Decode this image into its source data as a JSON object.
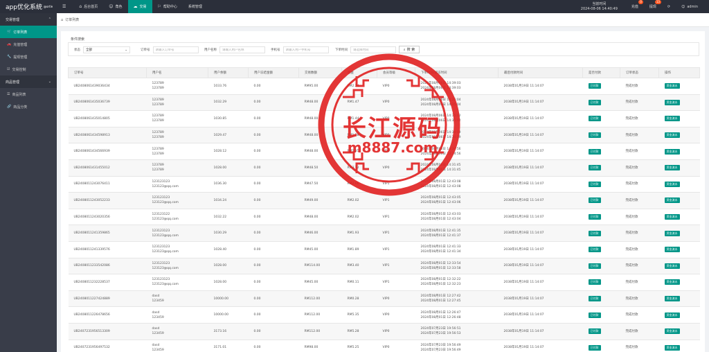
{
  "app": {
    "title": "app优化系统",
    "version": "@ortle"
  },
  "topnav": [
    {
      "icon": "menu-icon",
      "label": ""
    },
    {
      "icon": "home-icon",
      "label": "后台首页"
    },
    {
      "icon": "user-icon",
      "label": "角色"
    },
    {
      "icon": "transaction-icon",
      "label": "交易"
    },
    {
      "icon": "flag-icon",
      "label": "帮助中心"
    },
    {
      "icon": "",
      "label": "系统管理"
    }
  ],
  "header": {
    "clock_label": "当前时间",
    "clock_value": "2024-08-06 14:40:49",
    "recharge_label": "充值",
    "recharge_badge": "0",
    "withdraw_label": "提现",
    "withdraw_badge": "13",
    "user": "admin"
  },
  "sidebar": {
    "group1": "交易管理",
    "items1": [
      {
        "label": "订单列表",
        "icon": "cart-icon"
      },
      {
        "label": "充值管理",
        "icon": "car-icon"
      },
      {
        "label": "提现管理",
        "icon": "wrench-icon"
      },
      {
        "label": "交易控制",
        "icon": "check-icon"
      }
    ],
    "group2": "商品管理",
    "items2": [
      {
        "label": "商品列表",
        "icon": "list-icon"
      },
      {
        "label": "商品分类",
        "icon": "link-icon"
      }
    ]
  },
  "tab": {
    "label": "订单列表"
  },
  "search": {
    "title": "条件搜索",
    "status_label": "状态",
    "status_value": "全部",
    "order_label": "订单号",
    "order_placeholder": "请输入订单号",
    "username_label": "用户名称",
    "username_placeholder": "请输入用户名称",
    "phone_label": "手机号",
    "phone_placeholder": "请输入用户手机号",
    "time_label": "下单时间",
    "time_placeholder": "请选择时间",
    "button": "搜 索"
  },
  "table": {
    "headers": [
      "订单号",
      "用户名",
      "用户余额",
      "用户冻结金额",
      "交易数额",
      "佣金",
      "会员等级",
      "下单时间/解冻时间",
      "最后付款时间",
      "是否付款",
      "订单状态",
      "操作"
    ],
    "paid_tag": "已付款",
    "flow_tag": "资金流水",
    "rows": [
      {
        "id": "UB2408061439036434",
        "user1": "123789",
        "user2": "123789",
        "balance": "1033.76",
        "frozen": "0.00",
        "amount": "RM95.00",
        "comm": "RM2.24",
        "vip": "VIP0",
        "t1": "2024年08月06日 14:39:03",
        "t2": "2024年08月06日 14:39:03",
        "last": "2038年01月19日 11:14:07",
        "status": "完成付款"
      },
      {
        "id": "UB2408061435036739",
        "user1": "123789",
        "user2": "123789",
        "balance": "1032.29",
        "frozen": "0.00",
        "amount": "RM48.00",
        "comm": "RM1.47",
        "vip": "VIP0",
        "t1": "2024年08月06日 14:35:04",
        "t2": "2024年08月06日 14:35:04",
        "last": "2038年01月19日 11:14:07",
        "status": "完成付款"
      },
      {
        "id": "UB2408061435014805",
        "user1": "123789",
        "user2": "123789",
        "balance": "1030.85",
        "frozen": "0.00",
        "amount": "RM48.00",
        "comm": "RM1.44",
        "vip": "VIP0",
        "t1": "2024年08月06日 14:35:02",
        "t2": "2024年08月06日 14:35:02",
        "last": "2038年01月19日 11:14:07",
        "status": "完成付款"
      },
      {
        "id": "UB2408061434598913",
        "user1": "123789",
        "user2": "123789",
        "balance": "1029.47",
        "frozen": "0.00",
        "amount": "RM48.00",
        "comm": "RM1.38",
        "vip": "VIP0",
        "t1": "2024年08月06日 14:34:59",
        "t2": "2024年08月06日 14:34:59",
        "last": "2038年01月19日 11:14:07",
        "status": "完成付款"
      },
      {
        "id": "UB2408061434566939",
        "user1": "123789",
        "user2": "123789",
        "balance": "1028.12",
        "frozen": "0.00",
        "amount": "RM48.00",
        "comm": "RM1.35",
        "vip": "VIP0",
        "t1": "2024年08月06日 14:34:56",
        "t2": "2024年08月06日 14:34:56",
        "last": "2038年01月19日 11:14:07",
        "status": "完成付款"
      },
      {
        "id": "UB2408061431455012",
        "user1": "123789",
        "user2": "123789",
        "balance": "1028.00",
        "frozen": "0.00",
        "amount": "RM48.50",
        "comm": "RM3.12",
        "vip": "VIP0",
        "t1": "2024年08月06日 14:31:45",
        "t2": "2024年08月06日 14:31:45",
        "last": "2038年01月19日 11:14:07",
        "status": "完成付款"
      },
      {
        "id": "UB2408011243076411",
        "user1": "123123123",
        "user2": "123123@qq.com",
        "balance": "1036.30",
        "frozen": "0.00",
        "amount": "RM47.50",
        "comm": "RM2.06",
        "vip": "VIP1",
        "t1": "2024年08月01日 12:43:08",
        "t2": "2024年08月01日 12:43:08",
        "last": "2038年01月19日 11:14:07",
        "status": "完成付款"
      },
      {
        "id": "UB2408011243052233",
        "user1": "123123123",
        "user2": "123123@qq.com",
        "balance": "1034.24",
        "frozen": "0.00",
        "amount": "RM49.00",
        "comm": "RM2.02",
        "vip": "VIP1",
        "t1": "2024年08月01日 12:43:05",
        "t2": "2024年08月01日 12:43:06",
        "last": "2038年01月19日 11:14:07",
        "status": "完成付款"
      },
      {
        "id": "UB2408011243020356",
        "user1": "123123122",
        "user2": "123123@qq.com",
        "balance": "1032.22",
        "frozen": "0.00",
        "amount": "RM48.00",
        "comm": "RM2.02",
        "vip": "VIP1",
        "t1": "2024年08月01日 12:43:03",
        "t2": "2024年08月01日 12:43:04",
        "last": "2038年01月19日 11:14:07",
        "status": "完成付款"
      },
      {
        "id": "UB2408011241359865",
        "user1": "123123123",
        "user2": "123123@qq.com",
        "balance": "1030.29",
        "frozen": "0.00",
        "amount": "RM46.00",
        "comm": "RM1.93",
        "vip": "VIP1",
        "t1": "2024年08月01日 12:41:35",
        "t2": "2024年08月01日 12:41:37",
        "last": "2038年01月19日 11:14:07",
        "status": "完成付款"
      },
      {
        "id": "UB2408011241339576",
        "user1": "123123123",
        "user2": "123123@qq.com",
        "balance": "1028.40",
        "frozen": "0.00",
        "amount": "RM45.00",
        "comm": "RM1.89",
        "vip": "VIP1",
        "t1": "2024年08月01日 12:41:33",
        "t2": "2024年08月01日 12:41:34",
        "last": "2038年01月19日 11:14:07",
        "status": "完成付款"
      },
      {
        "id": "UB2408011233542086",
        "user1": "123123123",
        "user2": "123123@qq.com",
        "balance": "1028.00",
        "frozen": "0.00",
        "amount": "RM114.00",
        "comm": "RM3.40",
        "vip": "VIP1",
        "t1": "2024年08月01日 12:33:54",
        "t2": "2024年08月01日 12:33:58",
        "last": "2038年01月19日 11:14:07",
        "status": "完成付款"
      },
      {
        "id": "UB2408011232228537",
        "user1": "123123123",
        "user2": "123123@qq.com",
        "balance": "1028.00",
        "frozen": "0.00",
        "amount": "RM45.00",
        "comm": "RM0.11",
        "vip": "VIP1",
        "t1": "2024年08月01日 12:32:22",
        "t2": "2024年08月01日 12:32:23",
        "last": "2038年01月19日 11:14:07",
        "status": "完成付款"
      },
      {
        "id": "UB2408011227424889",
        "user1": "dasd",
        "user2": "123459",
        "balance": "10000.00",
        "frozen": "0.00",
        "amount": "RM112.00",
        "comm": "RM0.28",
        "vip": "VIP0",
        "t1": "2024年08月01日 12:27:42",
        "t2": "2024年08月01日 12:27:45",
        "last": "2038年01月19日 11:14:07",
        "status": "完成付款"
      },
      {
        "id": "UB2408011226478656",
        "user1": "dasd",
        "user2": "123459",
        "balance": "10000.00",
        "frozen": "0.00",
        "amount": "RM112.00",
        "comm": "RM5.35",
        "vip": "VIP0",
        "t1": "2024年08月01日 12:26:47",
        "t2": "2024年08月01日 12:26:48",
        "last": "2038年01月19日 11:14:07",
        "status": "完成付款"
      },
      {
        "id": "UB2407231956513309",
        "user1": "dasd",
        "user2": "123459",
        "balance": "3173.16",
        "frozen": "0.00",
        "amount": "RM112.00",
        "comm": "RM5.28",
        "vip": "VIP0",
        "t1": "2024年07月23日 19:56:51",
        "t2": "2024年07月23日 19:56:53",
        "last": "2038年01月19日 11:14:07",
        "status": "完成付款"
      },
      {
        "id": "UB2407231956497532",
        "user1": "dasd",
        "user2": "123459",
        "balance": "3171.01",
        "frozen": "0.00",
        "amount": "RM98.00",
        "comm": "RM5.25",
        "vip": "VIP0",
        "t1": "2024年07月23日 19:56:49",
        "t2": "2024年07月23日 19:56:49",
        "last": "2038年01月19日 11:14:07",
        "status": "完成付款"
      }
    ]
  },
  "watermark": {
    "line1": "长江源码",
    "line2": "m8887.com",
    "color": "#e02020"
  },
  "colors": {
    "accent": "#009688",
    "topbar": "#2b2f3a",
    "sidebar": "#393d49",
    "badge": "#ff5722"
  }
}
